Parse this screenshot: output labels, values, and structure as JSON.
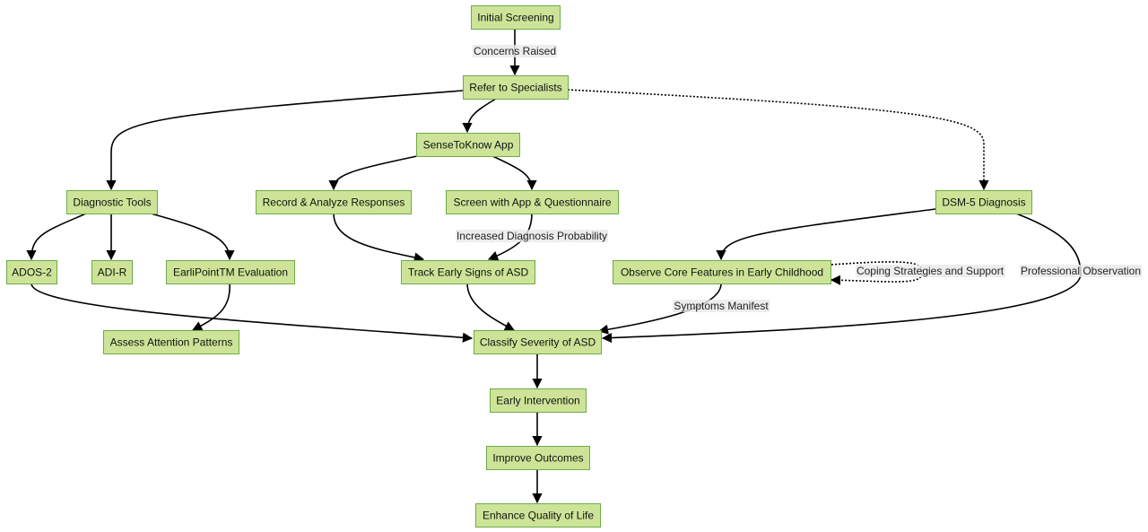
{
  "diagram": {
    "type": "flowchart",
    "colors": {
      "node_fill": "#cde498",
      "node_border": "#6eaa49",
      "edge": "#000000"
    },
    "nodes": [
      {
        "id": "initial",
        "label": "Initial Screening"
      },
      {
        "id": "refer",
        "label": "Refer to Specialists"
      },
      {
        "id": "sense",
        "label": "SenseToKnow App"
      },
      {
        "id": "diag",
        "label": "Diagnostic Tools"
      },
      {
        "id": "record",
        "label": "Record & Analyze Responses"
      },
      {
        "id": "screen",
        "label": "Screen with App & Questionnaire"
      },
      {
        "id": "dsm",
        "label": "DSM-5 Diagnosis"
      },
      {
        "id": "ados",
        "label": "ADOS-2"
      },
      {
        "id": "adir",
        "label": "ADI-R"
      },
      {
        "id": "earli",
        "label": "EarliPointTM Evaluation"
      },
      {
        "id": "track",
        "label": "Track Early Signs of ASD"
      },
      {
        "id": "observe",
        "label": "Observe Core Features in Early Childhood"
      },
      {
        "id": "assess",
        "label": "Assess Attention Patterns"
      },
      {
        "id": "classify",
        "label": "Classify Severity of ASD"
      },
      {
        "id": "early",
        "label": "Early Intervention"
      },
      {
        "id": "improve",
        "label": "Improve Outcomes"
      },
      {
        "id": "enhance",
        "label": "Enhance Quality of Life"
      }
    ],
    "edges": [
      {
        "from": "initial",
        "to": "refer",
        "label": "Concerns Raised",
        "style": "solid"
      },
      {
        "from": "refer",
        "to": "diag",
        "label": "",
        "style": "solid"
      },
      {
        "from": "refer",
        "to": "sense",
        "label": "",
        "style": "solid"
      },
      {
        "from": "refer",
        "to": "dsm",
        "label": "",
        "style": "dotted"
      },
      {
        "from": "diag",
        "to": "ados",
        "label": "",
        "style": "solid"
      },
      {
        "from": "diag",
        "to": "adir",
        "label": "",
        "style": "solid"
      },
      {
        "from": "diag",
        "to": "earli",
        "label": "",
        "style": "solid"
      },
      {
        "from": "sense",
        "to": "record",
        "label": "",
        "style": "solid"
      },
      {
        "from": "sense",
        "to": "screen",
        "label": "",
        "style": "solid"
      },
      {
        "from": "record",
        "to": "track",
        "label": "",
        "style": "solid"
      },
      {
        "from": "screen",
        "to": "track",
        "label": "Increased Diagnosis Probability",
        "style": "solid"
      },
      {
        "from": "dsm",
        "to": "observe",
        "label": "",
        "style": "solid"
      },
      {
        "from": "dsm",
        "to": "classify",
        "label": "Professional Observation",
        "style": "solid"
      },
      {
        "from": "observe",
        "to": "observe",
        "label": "Coping Strategies and Support",
        "style": "dotted"
      },
      {
        "from": "earli",
        "to": "assess",
        "label": "",
        "style": "solid"
      },
      {
        "from": "ados",
        "to": "classify",
        "label": "",
        "style": "solid"
      },
      {
        "from": "track",
        "to": "classify",
        "label": "",
        "style": "solid"
      },
      {
        "from": "observe",
        "to": "classify",
        "label": "Symptoms Manifest",
        "style": "solid"
      },
      {
        "from": "classify",
        "to": "early",
        "label": "",
        "style": "solid"
      },
      {
        "from": "early",
        "to": "improve",
        "label": "",
        "style": "solid"
      },
      {
        "from": "improve",
        "to": "enhance",
        "label": "",
        "style": "solid"
      }
    ]
  }
}
